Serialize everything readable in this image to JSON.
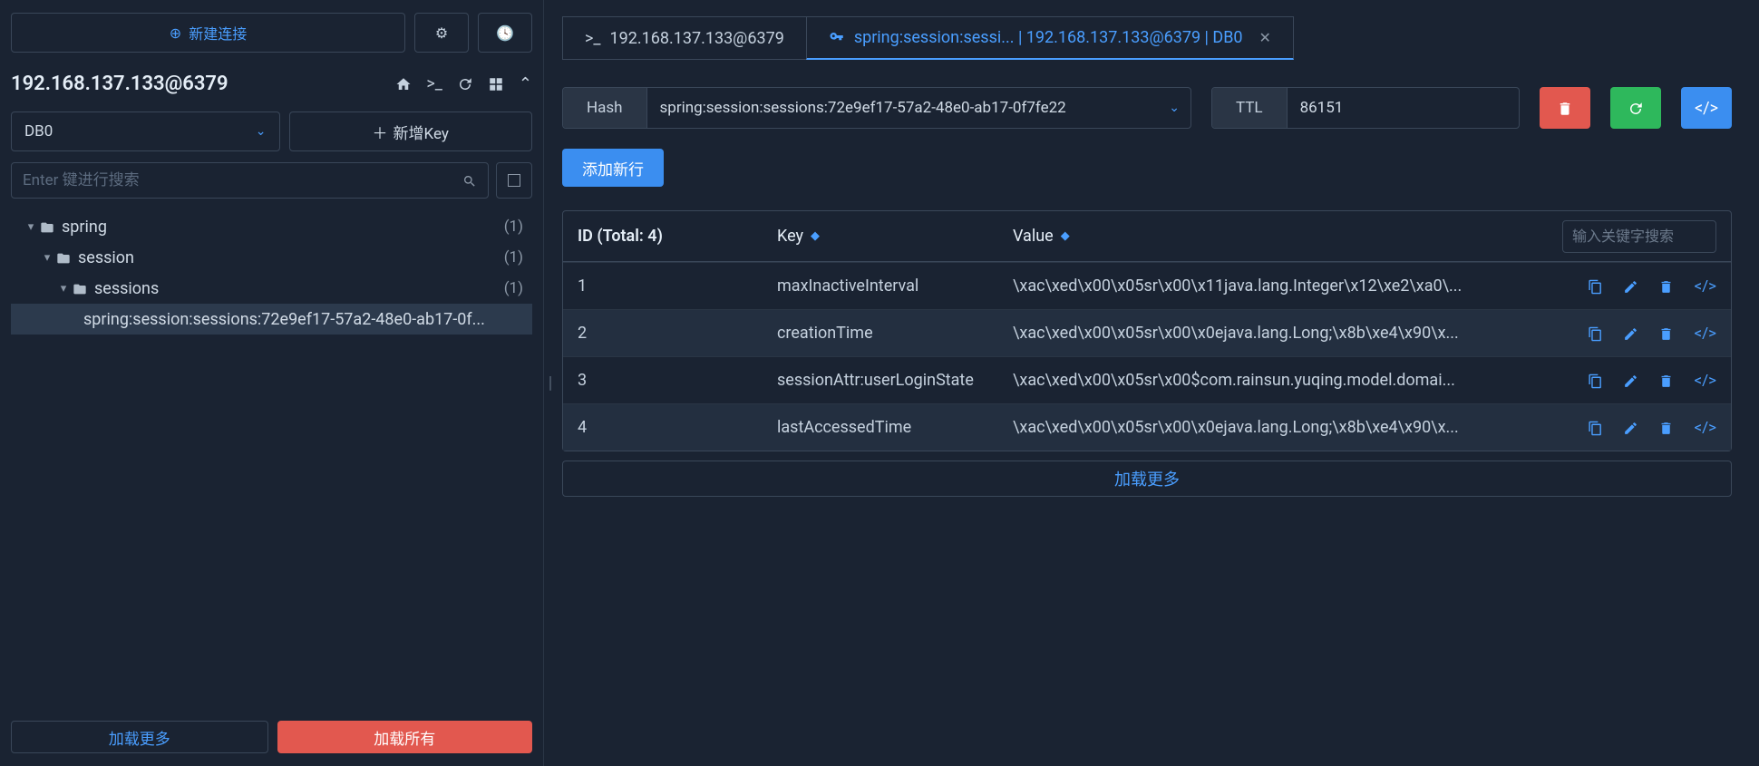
{
  "sidebar": {
    "new_connection": "新建连接",
    "connection_title": "192.168.137.133@6379",
    "db_selected": "DB0",
    "add_key": "新增Key",
    "search_placeholder": "Enter 键进行搜索",
    "tree": [
      {
        "label": "spring",
        "count": "(1)",
        "level": 0
      },
      {
        "label": "session",
        "count": "(1)",
        "level": 1
      },
      {
        "label": "sessions",
        "count": "(1)",
        "level": 2
      },
      {
        "label": "spring:session:sessions:72e9ef17-57a2-48e0-ab17-0f...",
        "level": 3,
        "selected": true
      }
    ],
    "load_more": "加载更多",
    "load_all": "加载所有"
  },
  "tabs": [
    {
      "icon": "terminal",
      "label": "192.168.137.133@6379",
      "active": false
    },
    {
      "icon": "key",
      "label": "spring:session:sessi... | 192.168.137.133@6379 | DB0",
      "active": true
    }
  ],
  "key_info": {
    "type_label": "Hash",
    "key_value": "spring:session:sessions:72e9ef17-57a2-48e0-ab17-0f7fe22",
    "ttl_label": "TTL",
    "ttl_value": "86151"
  },
  "add_row": "添加新行",
  "table": {
    "id_header": "ID (Total: 4)",
    "key_header": "Key",
    "value_header": "Value",
    "search_placeholder": "输入关键字搜索",
    "rows": [
      {
        "id": "1",
        "key": "maxInactiveInterval",
        "value": "\\xac\\xed\\x00\\x05sr\\x00\\x11java.lang.Integer\\x12\\xe2\\xa0\\..."
      },
      {
        "id": "2",
        "key": "creationTime",
        "value": "\\xac\\xed\\x00\\x05sr\\x00\\x0ejava.lang.Long;\\x8b\\xe4\\x90\\x..."
      },
      {
        "id": "3",
        "key": "sessionAttr:userLoginState",
        "value": "\\xac\\xed\\x00\\x05sr\\x00$com.rainsun.yuqing.model.domai..."
      },
      {
        "id": "4",
        "key": "lastAccessedTime",
        "value": "\\xac\\xed\\x00\\x05sr\\x00\\x0ejava.lang.Long;\\x8b\\xe4\\x90\\x..."
      }
    ],
    "load_more": "加载更多"
  }
}
